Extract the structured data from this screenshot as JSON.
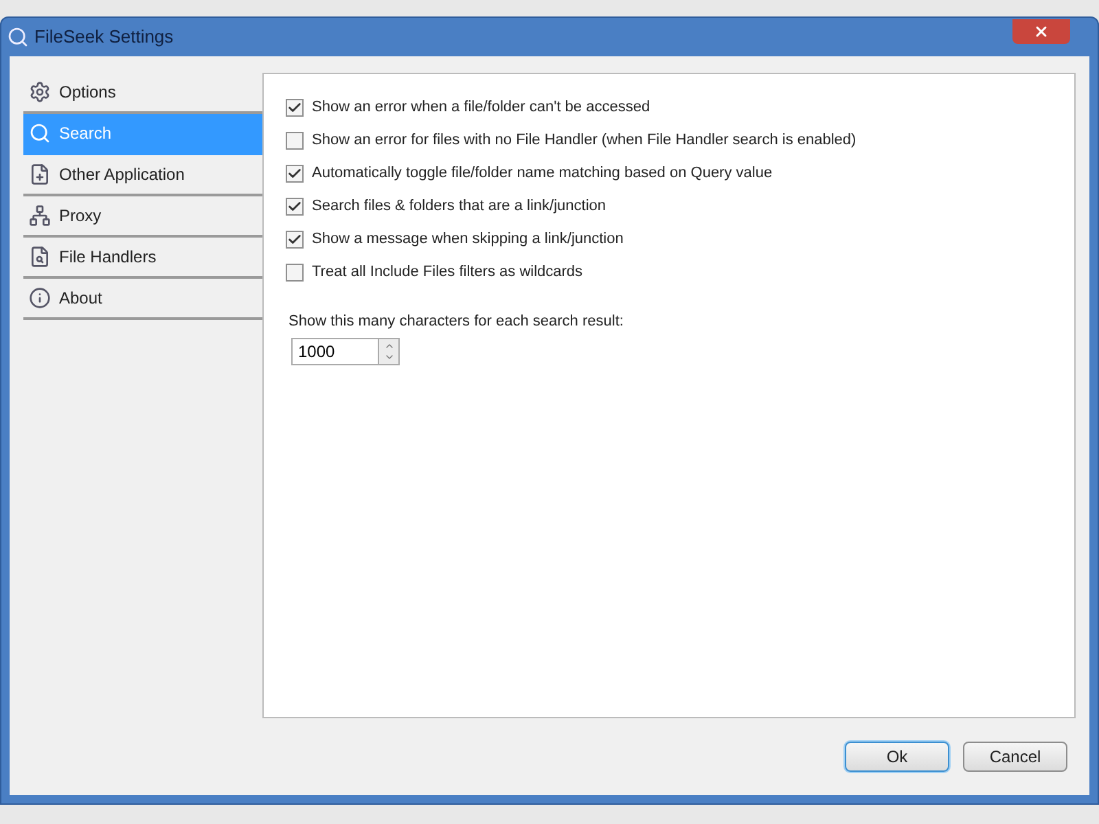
{
  "window": {
    "title": "FileSeek Settings"
  },
  "sidebar": {
    "items": [
      {
        "label": "Options",
        "selected": false
      },
      {
        "label": "Search",
        "selected": true
      },
      {
        "label": "Other Application",
        "selected": false
      },
      {
        "label": "Proxy",
        "selected": false
      },
      {
        "label": "File Handlers",
        "selected": false
      },
      {
        "label": "About",
        "selected": false
      }
    ]
  },
  "options": [
    {
      "label": "Show an error when a file/folder can't be accessed",
      "checked": true
    },
    {
      "label": "Show an error for files with no File Handler (when File Handler search is enabled)",
      "checked": false
    },
    {
      "label": "Automatically toggle file/folder name matching based on Query value",
      "checked": true
    },
    {
      "label": "Search files & folders that are a link/junction",
      "checked": true
    },
    {
      "label": "Show a message when skipping a link/junction",
      "checked": true
    },
    {
      "label": "Treat all Include Files filters as wildcards",
      "checked": false
    }
  ],
  "result_chars": {
    "label": "Show this many characters for each search result:",
    "value": "1000"
  },
  "buttons": [
    {
      "label": "Ok",
      "default": true
    },
    {
      "label": "Cancel",
      "default": false
    }
  ]
}
